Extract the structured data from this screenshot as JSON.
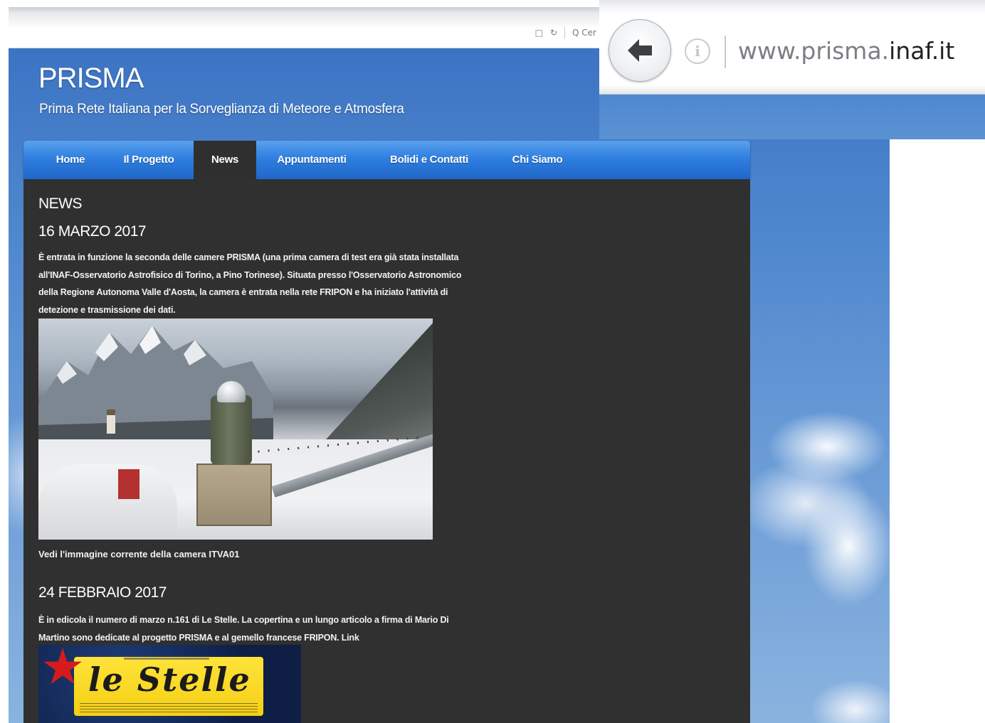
{
  "browser": {
    "toolbar_icons": [
      "bookmark-icon",
      "refresh-icon",
      "search-icon"
    ],
    "search_hint": "Q Cer",
    "zoom_url": {
      "prefix": "www.prisma.",
      "domain": "inaf.it"
    }
  },
  "site": {
    "title": "PRISMA",
    "subtitle": "Prima Rete Italiana per la Sorveglianza di Meteore e Atmosfera"
  },
  "nav": {
    "items": [
      {
        "label": "Home"
      },
      {
        "label": "Il Progetto"
      },
      {
        "label": "News"
      },
      {
        "label": "Appuntamenti"
      },
      {
        "label": "Bolidi e Contatti"
      },
      {
        "label": "Chi Siamo"
      }
    ],
    "active": "News"
  },
  "content": {
    "section_title": "NEWS",
    "posts": [
      {
        "date": "16 MARZO 2017",
        "lines": [
          "È entrata in funzione la seconda delle camere PRISMA (una prima camera di test era già stata installata",
          "all'INAF-Osservatorio Astrofisico di Torino, a Pino Torinese). Situata presso l'Osservatorio Astronomico",
          "della Regione Autonoma Valle d'Aosta, la camera è entrata nella rete FRIPON e ha iniziato l'attività di",
          "detezione e trasmissione dei dati."
        ],
        "caption": "Vedi l'immagine corrente della camera ITVA01"
      },
      {
        "date": "24 FEBBRAIO 2017",
        "lines": [
          "È in edicola il numero di marzo n.161 di Le Stelle. La copertina e un lungo articolo a firma di Mario Di",
          "Martino sono dedicate al progetto PRISMA e al gemello francese FRIPON. Link"
        ],
        "magazine_title": "le Stelle"
      }
    ]
  },
  "colors": {
    "nav_blue": "#2f7fe0",
    "panel_bg": "#303030",
    "sky": "#5189cf"
  }
}
